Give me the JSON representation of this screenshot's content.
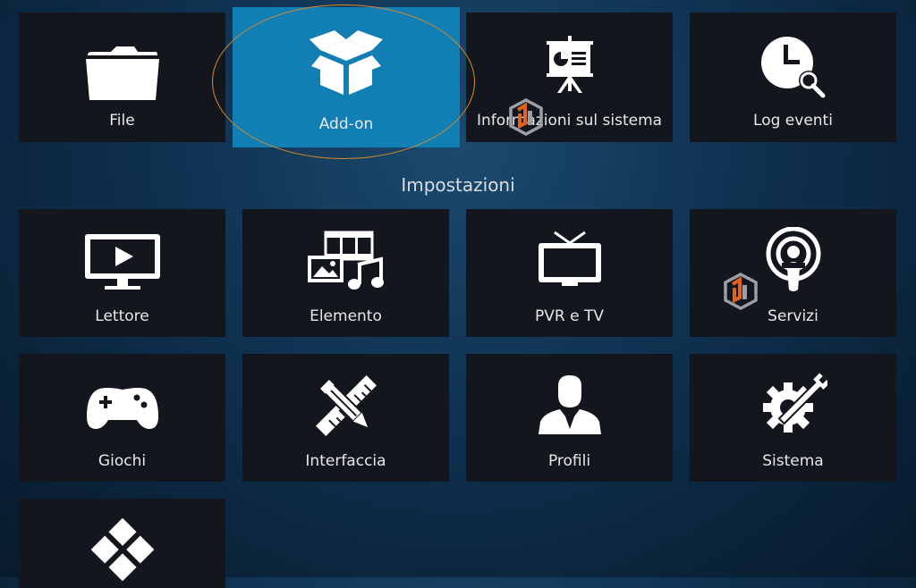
{
  "top_row": [
    {
      "label": "File",
      "icon": "folder-icon"
    },
    {
      "label": "Add-on",
      "icon": "addon-box-icon",
      "focused": true
    },
    {
      "label": "Informazioni sul sistema",
      "icon": "presentation-board-icon"
    },
    {
      "label": "Log eventi",
      "icon": "clock-search-icon"
    }
  ],
  "section_title": "Impostazioni",
  "settings": [
    {
      "label": "Lettore",
      "icon": "player-screen-icon"
    },
    {
      "label": "Elemento",
      "icon": "media-library-icon"
    },
    {
      "label": "PVR e TV",
      "icon": "tv-icon"
    },
    {
      "label": "Servizi",
      "icon": "broadcast-icon"
    },
    {
      "label": "Giochi",
      "icon": "gamepad-icon"
    },
    {
      "label": "Interfaccia",
      "icon": "pencil-ruler-icon"
    },
    {
      "label": "Profili",
      "icon": "user-profile-icon"
    },
    {
      "label": "Sistema",
      "icon": "gear-wrench-icon"
    },
    {
      "label": "",
      "icon": "diamond-grid-icon"
    }
  ],
  "colors": {
    "focus": "#127fb4",
    "tile": "#13161c",
    "highlight_ring": "#d9892a"
  }
}
